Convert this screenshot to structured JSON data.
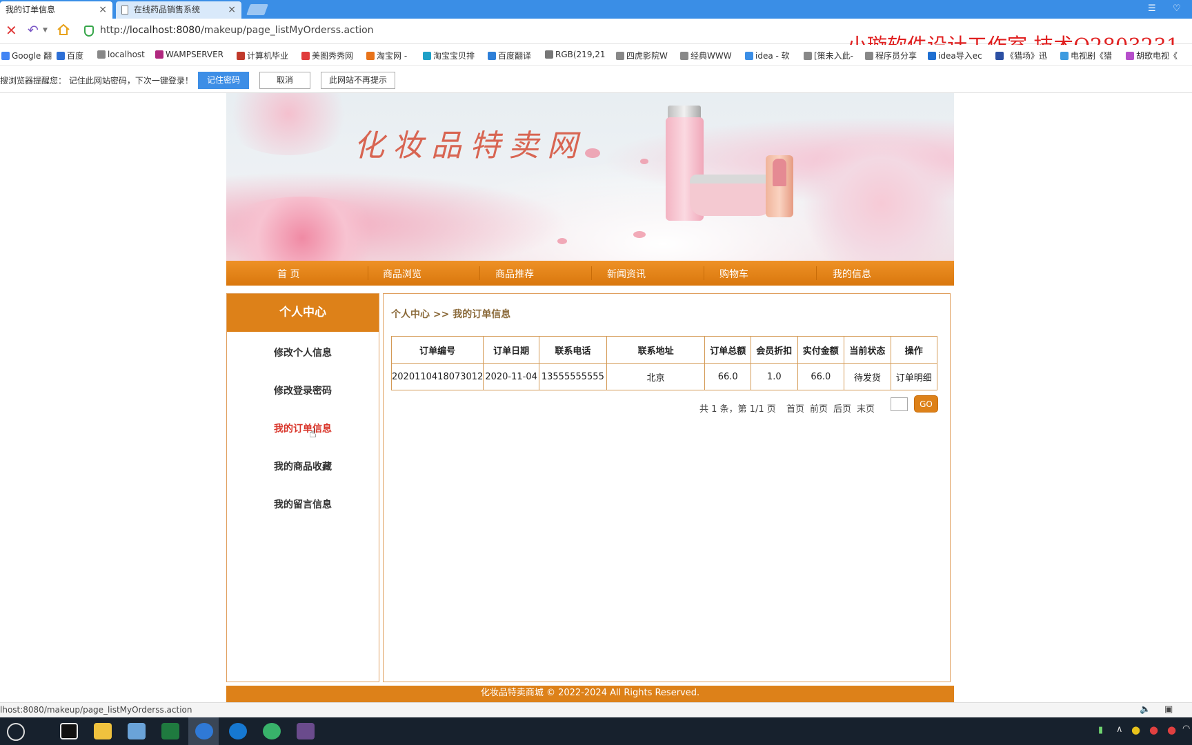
{
  "browser": {
    "tabs": [
      {
        "label": "我的订单信息",
        "close": "×"
      },
      {
        "label": "在线药品销售系统",
        "close": "×"
      }
    ],
    "url_prefix": "http://",
    "url_host": "localhost:8080",
    "url_path": "/makeup/page_listMyOrderss.action",
    "watermark": "小璇软件设计工作室 技术Q2803231",
    "bookmarks": [
      "Google 翻",
      "百度",
      "localhost",
      "WAMPSERVER",
      "计算机毕业",
      "美图秀秀网",
      "淘宝网 -",
      "淘宝宝贝排",
      "百度翻译",
      "RGB(219,21",
      "四虎影院W",
      "经典WWW",
      "idea - 软",
      "[策未入此-",
      "程序员分享",
      "idea导入ec",
      "《猎场》迅",
      "电视剧《猎",
      "胡歌电视《"
    ],
    "bookmark_colors": [
      "#4285f4",
      "#2d6fd6",
      "#888888",
      "#b0287f",
      "#c0392b",
      "#e03b3b",
      "#e8731a",
      "#1ea0c7",
      "#2d7fd8",
      "#777777",
      "#888888",
      "#888888",
      "#3b8ee6",
      "#888888",
      "#888888",
      "#1f6fd1",
      "#2b4fa3",
      "#3d9be0",
      "#b64ecb"
    ],
    "password_prompt": {
      "message": "搜浏览器提醒您：  记住此网站密码，下次一键登录！",
      "save": "记住密码",
      "cancel": "取消",
      "never": "此网站不再提示"
    },
    "status_url": "lhost:8080/makeup/page_listMyOrderss.action"
  },
  "site": {
    "banner_title": "化妆品特卖网",
    "nav": [
      "首 页",
      "商品浏览",
      "商品推荐",
      "新闻资讯",
      "购物车",
      "我的信息"
    ],
    "sidebar": {
      "title": "个人中心",
      "items": [
        "修改个人信息",
        "修改登录密码",
        "我的订单信息",
        "我的商品收藏",
        "我的留言信息"
      ],
      "current": "我的订单信息"
    },
    "breadcrumb": "个人中心 >> 我的订单信息",
    "table": {
      "headers": [
        "订单编号",
        "订单日期",
        "联系电话",
        "联系地址",
        "订单总额",
        "会员折扣",
        "实付金额",
        "当前状态",
        "操作"
      ],
      "rows": [
        [
          "2020110418073012",
          "2020-11-04",
          "13555555555",
          "北京",
          "66.0",
          "1.0",
          "66.0",
          "待发货",
          "订单明细"
        ]
      ]
    },
    "pager": {
      "summary": "共 1 条，第 1/1 页",
      "first": "首页",
      "prev": "前页",
      "next": "后页",
      "last": "末页",
      "go": "GO"
    },
    "footer": "化妆品特卖商城 © 2022-2024 All Rights Reserved.",
    "accent_color": "#dd8119"
  }
}
